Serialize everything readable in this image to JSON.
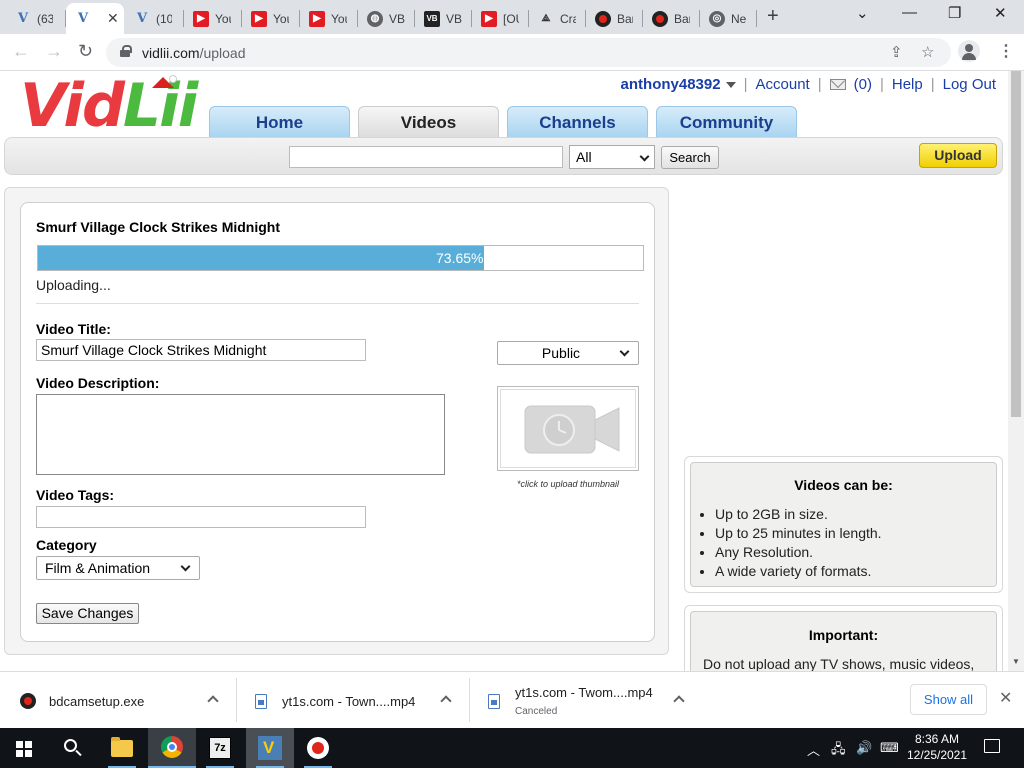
{
  "browser": {
    "tabs": [
      {
        "title": "(63",
        "icon": "vidlii-icon"
      },
      {
        "title": "",
        "icon": "vidlii-icon",
        "active": true
      },
      {
        "title": "(10",
        "icon": "vidlii-icon"
      },
      {
        "title": "You",
        "icon": "youtube-icon"
      },
      {
        "title": "You",
        "icon": "youtube-icon"
      },
      {
        "title": "You",
        "icon": "youtube-icon"
      },
      {
        "title": "VB",
        "icon": "globe-icon"
      },
      {
        "title": "VB",
        "icon": "vb-icon"
      },
      {
        "title": "[OU",
        "icon": "youtube-icon"
      },
      {
        "title": "Cra",
        "icon": "crane-icon"
      },
      {
        "title": "Bar",
        "icon": "record-icon"
      },
      {
        "title": "Bar",
        "icon": "record-icon"
      },
      {
        "title": "Ne",
        "icon": "chrome-icon"
      }
    ],
    "new_tab": "+",
    "url_host": "vidlii.com",
    "url_path": "/upload"
  },
  "site": {
    "logo": {
      "part1": "Vid",
      "part2": "Lii"
    },
    "user": {
      "username": "anthony48392",
      "account": "Account",
      "inbox_count": "(0)",
      "help": "Help",
      "logout": "Log Out"
    },
    "nav": {
      "home": "Home",
      "videos": "Videos",
      "channels": "Channels",
      "community": "Community",
      "active": "Videos"
    },
    "search": {
      "value": "",
      "filter": "All",
      "button": "Search"
    },
    "upload_button": "Upload"
  },
  "upload": {
    "video_name": "Smurf Village Clock Strikes Midnight",
    "progress_percent": 73.65,
    "progress_label": "73.65%",
    "status": "Uploading...",
    "title_label": "Video Title:",
    "title_value": "Smurf Village Clock Strikes Midnight",
    "privacy": "Public",
    "description_label": "Video Description:",
    "description_value": "",
    "thumbnail_caption": "*click to upload thumbnail",
    "tags_label": "Video Tags:",
    "tags_value": "",
    "category_label": "Category",
    "category_value": "Film & Animation",
    "save_button": "Save Changes"
  },
  "sidebar": {
    "can_be_heading": "Videos can be:",
    "can_be_items": [
      "Up to 2GB in size.",
      "Up to 25 minutes in length.",
      "Any Resolution.",
      "A wide variety of formats."
    ],
    "important_heading": "Important:",
    "important_text": "Do not upload any TV shows, music videos,"
  },
  "downloads": {
    "items": [
      {
        "name": "bdcamsetup.exe",
        "sub": ""
      },
      {
        "name": "yt1s.com - Town....mp4",
        "sub": ""
      },
      {
        "name": "yt1s.com - Twom....mp4",
        "sub": "Canceled"
      }
    ],
    "show_all": "Show all"
  },
  "taskbar": {
    "time": "8:36 AM",
    "date": "12/25/2021",
    "apps": [
      "file-explorer",
      "chrome",
      "7zip",
      "vegas",
      "bandicam"
    ]
  },
  "colors": {
    "progress_fill": "#58aed8",
    "nav_tab": "#a9d3f0",
    "upload_button": "#f0cf00",
    "logo_red": "#e83a3f",
    "logo_green": "#4cba3f"
  }
}
